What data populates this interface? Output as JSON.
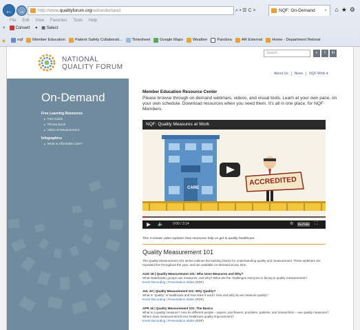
{
  "browser": {
    "address_prefix": "http://www.",
    "address_domain": "qualityforum.org",
    "address_path": "/ed/ondemand",
    "address_tools": "⌕ • ☰ C ×",
    "tab_title": "NQF: On-Demand",
    "menu": [
      "File",
      "Edit",
      "View",
      "Favorites",
      "Tools",
      "Help"
    ],
    "convert_label": "Convert",
    "select_label": "Select",
    "favorites": [
      "nqf",
      "Member Education",
      "Patient Safety Collaborati...",
      "Timesheet",
      "Google Maps",
      "Weather",
      "Pandora",
      "AR External",
      "Home - Department Retreat"
    ]
  },
  "header": {
    "logo_line1": "NATIONAL",
    "logo_line2": "QUALITY FORUM",
    "search_placeholder": "Search",
    "nav": [
      "About Us",
      "News",
      "NQF Work ▾"
    ]
  },
  "sidebar": {
    "title": "On-Demand",
    "section1_heading": "Free Learning Resources",
    "section1_links": [
      "Fact Guide",
      "Phrase Book",
      "ABCs of Measurement"
    ],
    "section2_heading": "Infographics",
    "section2_links": [
      "What is Affordable Care?"
    ]
  },
  "main": {
    "section_title": "Member Education Resource Center",
    "intro": "Please browse through on-demand webinars, videos, and visual tools. Learn at your own pace, on your own schedule. Download resources when you need them. It's all in one place, for NQF Members.",
    "video_title": "NQF: Quality Measures at Work",
    "video_time": "0:00 / 3:14",
    "video_building_sign": "CARE",
    "video_banner": "ACCREDITED",
    "caption": "This 3-minute video explains how measures help us get to quality healthcare.",
    "qm_title": "Quality Measurement 101",
    "qm_desc": "The Quality Measurement 101 series outlines the building blocks for understanding quality and measurement. These webinars are repeated five throughout the year, and are available on-demand at any time.",
    "episodes": [
      {
        "title": "AUG 18 | Quality Measurement 101: Who Uses Measures and Why?",
        "desc": "What stakeholder groups use measures, and why? What are the challenges everyone is facing in quality measurement?",
        "link1": "Event Recording",
        "link2": "Presentation Slides",
        "suffix": "(PDF)"
      },
      {
        "title": "JUL 20 | Quality Measurement 101: Why Quality?",
        "desc": "What is \"quality\" in healthcare and how does it work? How and why do we measure quality?",
        "link1": "Event Recording",
        "link2": "Presentation Slides",
        "suffix": "(PDF)"
      },
      {
        "title": "APR 16 | Quality Measurement 101: The Basics",
        "desc": "What is a quality measure? How do different people – payers, purchasers, providers, patients, and researchers – use quality measures? Where does measurement fit into healthcare quality improvement?",
        "link1": "Event Recording",
        "link2": "Presentation Slides",
        "suffix": "(PDF)"
      }
    ]
  },
  "colors": {
    "sidebar_bg": "#6f8b9d",
    "accent_orange": "#e0a23a",
    "link_blue": "#2d6cb0"
  }
}
